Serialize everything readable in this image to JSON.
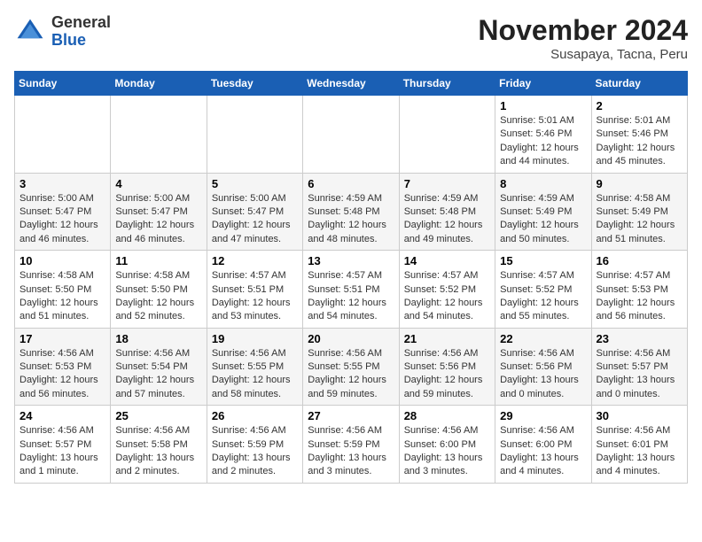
{
  "header": {
    "logo_general": "General",
    "logo_blue": "Blue",
    "month_title": "November 2024",
    "location": "Susapaya, Tacna, Peru"
  },
  "days_of_week": [
    "Sunday",
    "Monday",
    "Tuesday",
    "Wednesday",
    "Thursday",
    "Friday",
    "Saturday"
  ],
  "weeks": [
    [
      {
        "day": "",
        "info": ""
      },
      {
        "day": "",
        "info": ""
      },
      {
        "day": "",
        "info": ""
      },
      {
        "day": "",
        "info": ""
      },
      {
        "day": "",
        "info": ""
      },
      {
        "day": "1",
        "info": "Sunrise: 5:01 AM\nSunset: 5:46 PM\nDaylight: 12 hours\nand 44 minutes."
      },
      {
        "day": "2",
        "info": "Sunrise: 5:01 AM\nSunset: 5:46 PM\nDaylight: 12 hours\nand 45 minutes."
      }
    ],
    [
      {
        "day": "3",
        "info": "Sunrise: 5:00 AM\nSunset: 5:47 PM\nDaylight: 12 hours\nand 46 minutes."
      },
      {
        "day": "4",
        "info": "Sunrise: 5:00 AM\nSunset: 5:47 PM\nDaylight: 12 hours\nand 46 minutes."
      },
      {
        "day": "5",
        "info": "Sunrise: 5:00 AM\nSunset: 5:47 PM\nDaylight: 12 hours\nand 47 minutes."
      },
      {
        "day": "6",
        "info": "Sunrise: 4:59 AM\nSunset: 5:48 PM\nDaylight: 12 hours\nand 48 minutes."
      },
      {
        "day": "7",
        "info": "Sunrise: 4:59 AM\nSunset: 5:48 PM\nDaylight: 12 hours\nand 49 minutes."
      },
      {
        "day": "8",
        "info": "Sunrise: 4:59 AM\nSunset: 5:49 PM\nDaylight: 12 hours\nand 50 minutes."
      },
      {
        "day": "9",
        "info": "Sunrise: 4:58 AM\nSunset: 5:49 PM\nDaylight: 12 hours\nand 51 minutes."
      }
    ],
    [
      {
        "day": "10",
        "info": "Sunrise: 4:58 AM\nSunset: 5:50 PM\nDaylight: 12 hours\nand 51 minutes."
      },
      {
        "day": "11",
        "info": "Sunrise: 4:58 AM\nSunset: 5:50 PM\nDaylight: 12 hours\nand 52 minutes."
      },
      {
        "day": "12",
        "info": "Sunrise: 4:57 AM\nSunset: 5:51 PM\nDaylight: 12 hours\nand 53 minutes."
      },
      {
        "day": "13",
        "info": "Sunrise: 4:57 AM\nSunset: 5:51 PM\nDaylight: 12 hours\nand 54 minutes."
      },
      {
        "day": "14",
        "info": "Sunrise: 4:57 AM\nSunset: 5:52 PM\nDaylight: 12 hours\nand 54 minutes."
      },
      {
        "day": "15",
        "info": "Sunrise: 4:57 AM\nSunset: 5:52 PM\nDaylight: 12 hours\nand 55 minutes."
      },
      {
        "day": "16",
        "info": "Sunrise: 4:57 AM\nSunset: 5:53 PM\nDaylight: 12 hours\nand 56 minutes."
      }
    ],
    [
      {
        "day": "17",
        "info": "Sunrise: 4:56 AM\nSunset: 5:53 PM\nDaylight: 12 hours\nand 56 minutes."
      },
      {
        "day": "18",
        "info": "Sunrise: 4:56 AM\nSunset: 5:54 PM\nDaylight: 12 hours\nand 57 minutes."
      },
      {
        "day": "19",
        "info": "Sunrise: 4:56 AM\nSunset: 5:55 PM\nDaylight: 12 hours\nand 58 minutes."
      },
      {
        "day": "20",
        "info": "Sunrise: 4:56 AM\nSunset: 5:55 PM\nDaylight: 12 hours\nand 59 minutes."
      },
      {
        "day": "21",
        "info": "Sunrise: 4:56 AM\nSunset: 5:56 PM\nDaylight: 12 hours\nand 59 minutes."
      },
      {
        "day": "22",
        "info": "Sunrise: 4:56 AM\nSunset: 5:56 PM\nDaylight: 13 hours\nand 0 minutes."
      },
      {
        "day": "23",
        "info": "Sunrise: 4:56 AM\nSunset: 5:57 PM\nDaylight: 13 hours\nand 0 minutes."
      }
    ],
    [
      {
        "day": "24",
        "info": "Sunrise: 4:56 AM\nSunset: 5:57 PM\nDaylight: 13 hours\nand 1 minute."
      },
      {
        "day": "25",
        "info": "Sunrise: 4:56 AM\nSunset: 5:58 PM\nDaylight: 13 hours\nand 2 minutes."
      },
      {
        "day": "26",
        "info": "Sunrise: 4:56 AM\nSunset: 5:59 PM\nDaylight: 13 hours\nand 2 minutes."
      },
      {
        "day": "27",
        "info": "Sunrise: 4:56 AM\nSunset: 5:59 PM\nDaylight: 13 hours\nand 3 minutes."
      },
      {
        "day": "28",
        "info": "Sunrise: 4:56 AM\nSunset: 6:00 PM\nDaylight: 13 hours\nand 3 minutes."
      },
      {
        "day": "29",
        "info": "Sunrise: 4:56 AM\nSunset: 6:00 PM\nDaylight: 13 hours\nand 4 minutes."
      },
      {
        "day": "30",
        "info": "Sunrise: 4:56 AM\nSunset: 6:01 PM\nDaylight: 13 hours\nand 4 minutes."
      }
    ]
  ]
}
